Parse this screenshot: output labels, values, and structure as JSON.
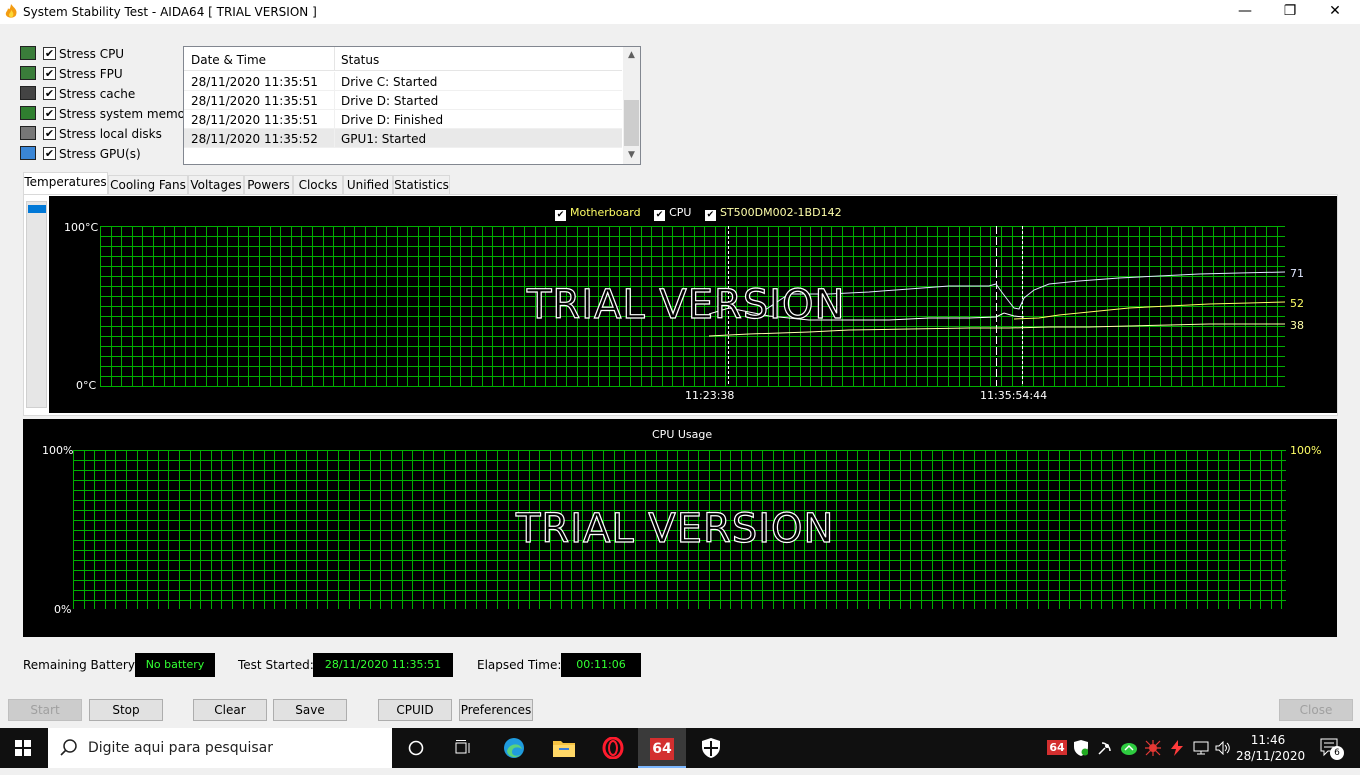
{
  "window": {
    "title": "System Stability Test - AIDA64  [ TRIAL VERSION ]",
    "minimize_glyph": "—",
    "maximize_glyph": "❐",
    "close_glyph": "✕"
  },
  "stress_options": [
    {
      "label": "Stress CPU",
      "checked": true,
      "icon": "cpu-chip-icon"
    },
    {
      "label": "Stress FPU",
      "checked": true,
      "icon": "fpu-chip-icon"
    },
    {
      "label": "Stress cache",
      "checked": true,
      "icon": "cache-chip-icon"
    },
    {
      "label": "Stress system memory",
      "checked": true,
      "icon": "memory-module-icon"
    },
    {
      "label": "Stress local disks",
      "checked": true,
      "icon": "disk-drive-icon"
    },
    {
      "label": "Stress GPU(s)",
      "checked": true,
      "icon": "monitor-icon"
    }
  ],
  "log": {
    "col_datetime": "Date & Time",
    "col_status": "Status",
    "rows": [
      {
        "datetime": "28/11/2020 11:35:51",
        "status": "Drive C: Started"
      },
      {
        "datetime": "28/11/2020 11:35:51",
        "status": "Drive D: Started"
      },
      {
        "datetime": "28/11/2020 11:35:51",
        "status": "Drive D: Finished"
      },
      {
        "datetime": "28/11/2020 11:35:52",
        "status": "GPU1: Started"
      }
    ]
  },
  "tabs": [
    "Temperatures",
    "Cooling Fans",
    "Voltages",
    "Powers",
    "Clocks",
    "Unified",
    "Statistics"
  ],
  "active_tab": "Temperatures",
  "temperature_graph": {
    "legend": [
      {
        "name": "Motherboard",
        "color": "#ffff66",
        "checked": true
      },
      {
        "name": "CPU",
        "color": "#ffffff",
        "checked": true
      },
      {
        "name": "ST500DM002-1BD142",
        "color": "#ffffaa",
        "checked": true
      }
    ],
    "y_max_label": "100°C",
    "y_min_label": "0°C",
    "time_label_1": "11:23:38",
    "time_label_2": "11:35:54:44",
    "watermark": "TRIAL VERSION",
    "current_cpu": "71",
    "current_motherboard": "52",
    "current_disk": "38",
    "grid_color": "#00b000"
  },
  "cpu_graph": {
    "title": "CPU Usage",
    "y_max_left": "100%",
    "y_min_left": "0%",
    "y_max_right": "100%",
    "watermark": "TRIAL VERSION"
  },
  "status": {
    "battery_label": "Remaining Battery:",
    "battery_value": "No battery",
    "started_label": "Test Started:",
    "started_value": "28/11/2020 11:35:51",
    "elapsed_label": "Elapsed Time:",
    "elapsed_value": "00:11:06"
  },
  "buttons": {
    "start": "Start",
    "stop": "Stop",
    "clear": "Clear",
    "save": "Save",
    "cpuid": "CPUID",
    "preferences": "Preferences",
    "close": "Close"
  },
  "taskbar": {
    "search_placeholder": "Digite aqui para pesquisar",
    "time": "11:46",
    "date": "28/11/2020",
    "notification_count": "6",
    "aida_tray_label": "64",
    "aida_app_label": "64"
  }
}
